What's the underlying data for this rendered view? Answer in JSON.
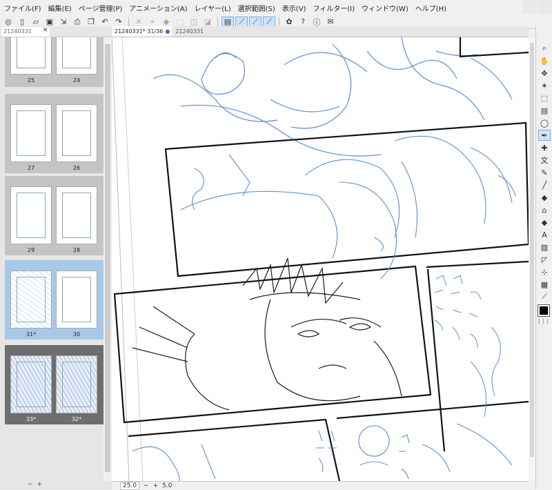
{
  "menu": [
    "ファイル(F)",
    "編集(E)",
    "ページ管理(P)",
    "アニメーション(A)",
    "レイヤー(L)",
    "選択範囲(S)",
    "表示(V)",
    "フィルター(I)",
    "ウィンドウ(W)",
    "ヘルプ(H)"
  ],
  "toolbar": {
    "icons": [
      "app-logo-icon",
      "new-file-icon",
      "open-file-icon",
      "save-icon",
      "export-icon",
      "print-icon",
      "book-icon",
      "undo-icon",
      "redo-icon",
      "clear-icon",
      "transform-icon",
      "fill-icon",
      "selection-icon",
      "deselect-icon",
      "invert-icon",
      "stroke-icon",
      "pen-snap-icon",
      "ruler-snap-icon",
      "grid-snap-icon",
      "settings-icon",
      "help-icon",
      "info-icon",
      "message-icon"
    ]
  },
  "left_panel": {
    "tab_label": "21240331",
    "spreads": [
      {
        "left": "25",
        "right": "24",
        "state": "normal"
      },
      {
        "left": "27",
        "right": "26",
        "state": "normal"
      },
      {
        "left": "29",
        "right": "28",
        "state": "normal"
      },
      {
        "left": "31*",
        "right": "30",
        "state": "selected"
      },
      {
        "left": "33*",
        "right": "32*",
        "state": "dark"
      }
    ],
    "status": {
      "minus": "−",
      "plus": "+"
    }
  },
  "doc_tabs": [
    {
      "label": "21240331* 31/36",
      "active": true
    },
    {
      "label": "21240331",
      "active": false
    }
  ],
  "canvas_status": {
    "zoom": "25.0",
    "minus": "−",
    "plus": "+",
    "angle": "5.0"
  },
  "tools": [
    "zoom-icon",
    "hand-icon",
    "move-icon",
    "star-icon",
    "rect-select-icon",
    "layer-select-icon",
    "lasso-icon",
    "pen-icon",
    "dropper-icon",
    "text-icon",
    "brush-icon",
    "line-icon",
    "fill-icon",
    "gradient-icon",
    "eraser-icon",
    "type-icon",
    "figure-icon",
    "frame-icon",
    "vector-icon",
    "table-icon",
    "eyedropper-icon"
  ],
  "colors": {
    "accent": "#3b6fd0",
    "sketch_blue": "#5b8ed6",
    "ink": "#1a1a1a"
  }
}
